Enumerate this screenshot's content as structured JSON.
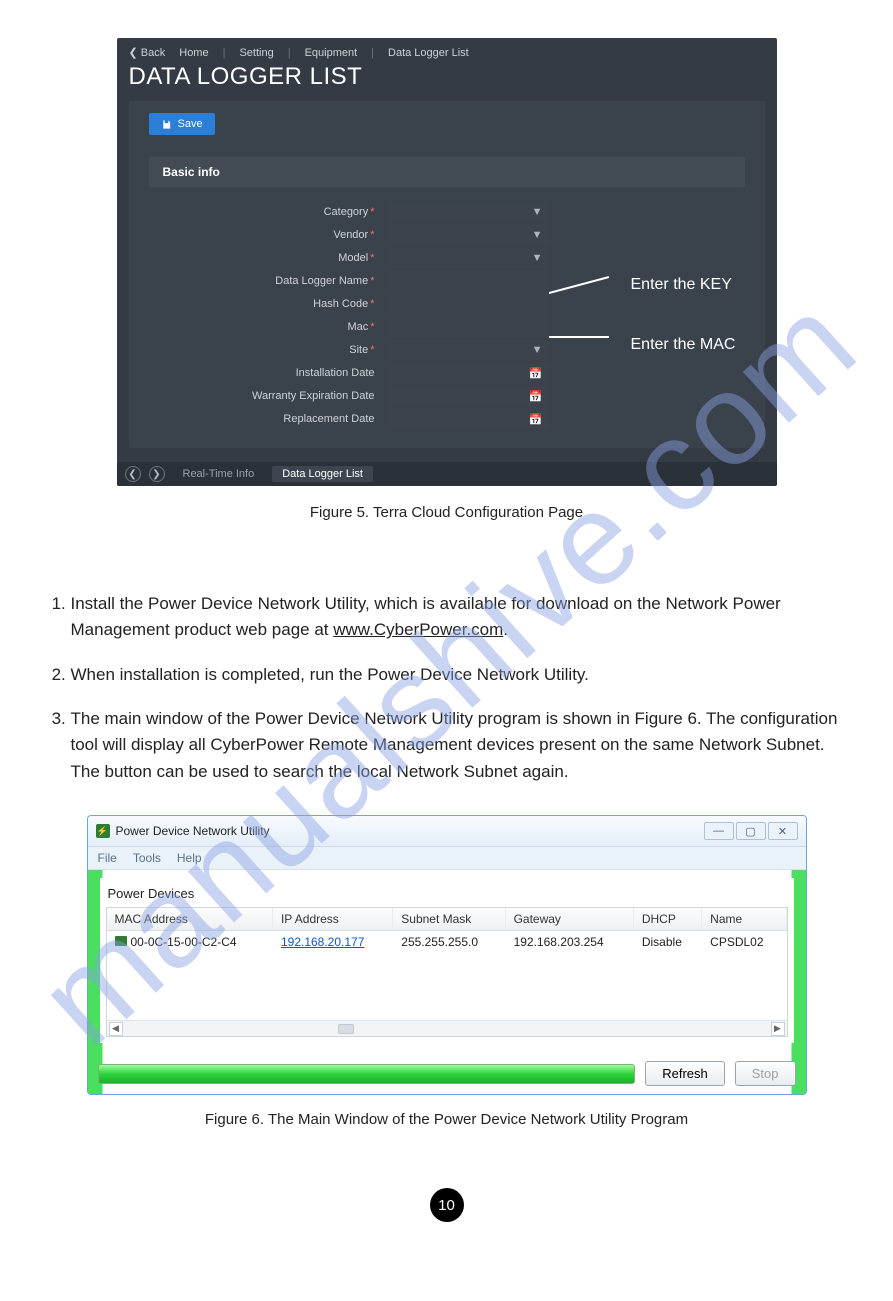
{
  "watermark": "manualshive.com",
  "fig5": {
    "breadcrumb": {
      "back": "Back",
      "items": [
        "Home",
        "Setting",
        "Equipment",
        "Data Logger List"
      ]
    },
    "title": "DATA LOGGER LIST",
    "save_label": "Save",
    "section_title": "Basic info",
    "fields": [
      {
        "label": "Category",
        "required": true,
        "type": "select"
      },
      {
        "label": "Vendor",
        "required": true,
        "type": "select"
      },
      {
        "label": "Model",
        "required": true,
        "type": "select"
      },
      {
        "label": "Data Logger Name",
        "required": true,
        "type": "text"
      },
      {
        "label": "Hash Code",
        "required": true,
        "type": "text"
      },
      {
        "label": "Mac",
        "required": true,
        "type": "text"
      },
      {
        "label": "Site",
        "required": true,
        "type": "select"
      },
      {
        "label": "Installation Date",
        "required": false,
        "type": "date"
      },
      {
        "label": "Warranty Expiration Date",
        "required": false,
        "type": "date"
      },
      {
        "label": "Replacement Date",
        "required": false,
        "type": "date"
      }
    ],
    "callout_key": "Enter the KEY",
    "callout_mac": "Enter the MAC",
    "footer_tabs": {
      "realtime": "Real-Time Info",
      "list": "Data Logger List"
    },
    "caption": "Figure 5. Terra Cloud Configuration Page"
  },
  "steps": {
    "s1a": "Install the Power Device Network Utility, which is available for download on the Network Power Management product web page at ",
    "s1_link": "www.CyberPower.com",
    "s1b": ".",
    "s2": "When installation is completed, run the Power Device Network Utility.",
    "s3": "The main window of the Power Device Network Utility program is shown in Figure 6. The configuration tool will display all CyberPower Remote Management devices present on the same Network Subnet. The             button can be used to search the local Network Subnet again."
  },
  "fig6": {
    "title": "Power Device Network Utility",
    "menu": [
      "File",
      "Tools",
      "Help"
    ],
    "group_label": "Power Devices",
    "columns": [
      "MAC Address",
      "IP Address",
      "Subnet Mask",
      "Gateway",
      "DHCP",
      "Name"
    ],
    "row": {
      "mac": "00-0C-15-00-C2-C4",
      "ip": "192.168.20.177",
      "mask": "255.255.255.0",
      "gw": "192.168.203.254",
      "dhcp": "Disable",
      "name": "CPSDL02"
    },
    "refresh": "Refresh",
    "stop": "Stop",
    "caption": "Figure 6. The Main Window of the Power Device Network Utility Program"
  },
  "page_number": "10"
}
